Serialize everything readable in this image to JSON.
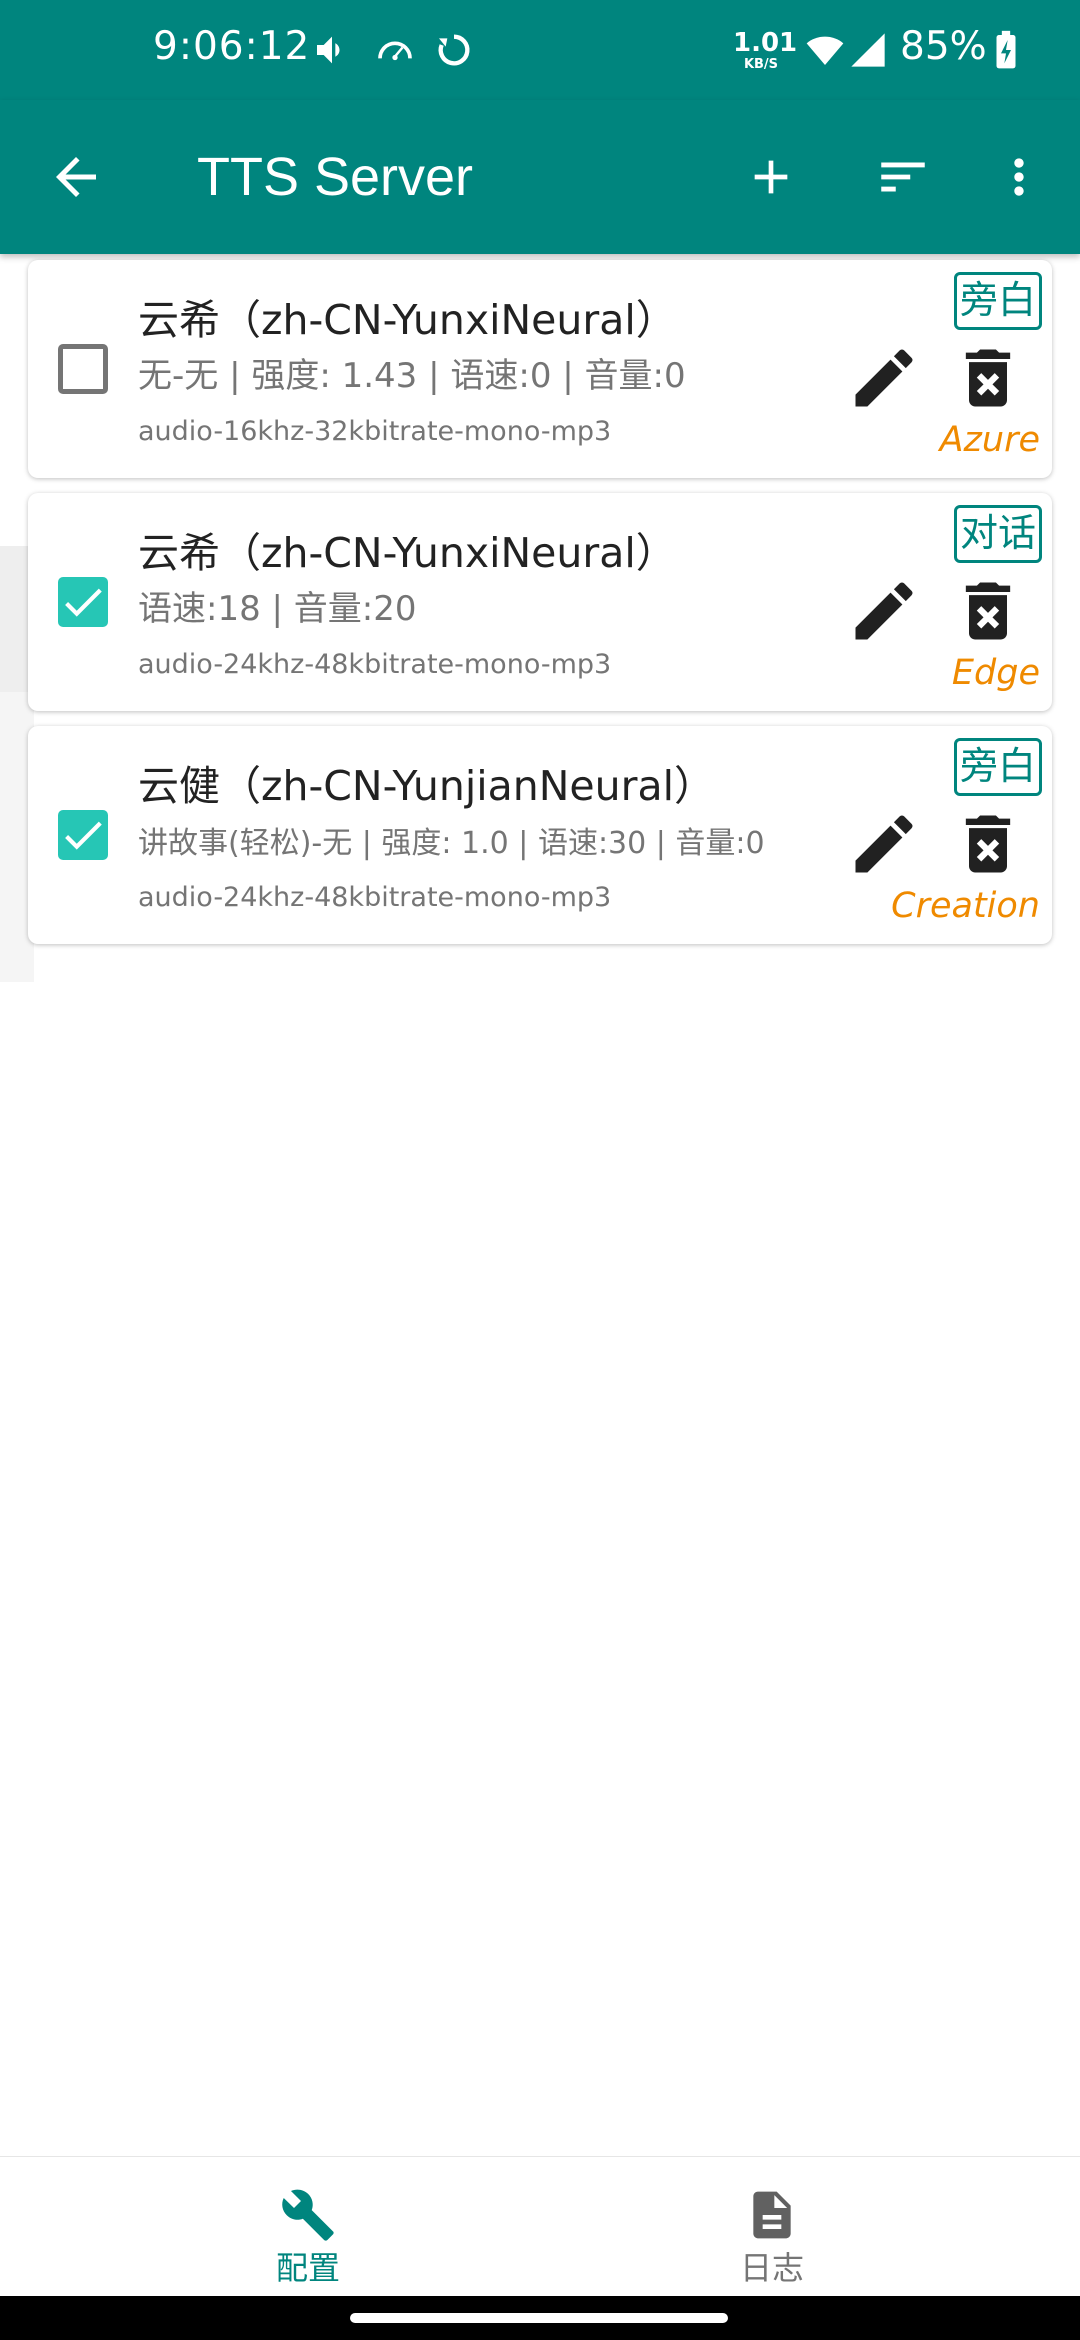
{
  "status_bar": {
    "time": "9:06:12",
    "net_speed_value": "1.01",
    "net_speed_unit": "KB/S",
    "battery": "85%"
  },
  "app_bar": {
    "title": "TTS Server",
    "icons": [
      "arrow-back-icon",
      "add-icon",
      "sort-icon",
      "more-vert-icon"
    ]
  },
  "configs": [
    {
      "voice": "云希（zh-CN-YunxiNeural）",
      "params": "无-无 | 强度: 1.43 | 语速:0 | 音量:0",
      "format": "audio-16khz-32kbitrate-mono-mp3",
      "tag": "旁白",
      "api": "Azure",
      "enabled": false
    },
    {
      "voice": "云希（zh-CN-YunxiNeural）",
      "params": "语速:18 | 音量:20",
      "format": "audio-24khz-48kbitrate-mono-mp3",
      "tag": "对话",
      "api": "Edge",
      "enabled": true
    },
    {
      "voice": "云健（zh-CN-YunjianNeural）",
      "params": "讲故事(轻松)-无 | 强度: 1.0 | 语速:30 | 音量:0",
      "format": "audio-24khz-48kbitrate-mono-mp3",
      "tag": "旁白",
      "api": "Creation",
      "enabled": true
    }
  ],
  "bottom_nav": {
    "items": [
      {
        "label": "配置",
        "icon": "wrench-icon",
        "selected": true
      },
      {
        "label": "日志",
        "icon": "document-icon",
        "selected": false
      }
    ]
  },
  "colors": {
    "primary": "#00857e",
    "checkbox_on": "#26c6b5",
    "api_label": "#ef8a00",
    "nav_selected": "#00857e",
    "nav_unselected": "#757575"
  }
}
